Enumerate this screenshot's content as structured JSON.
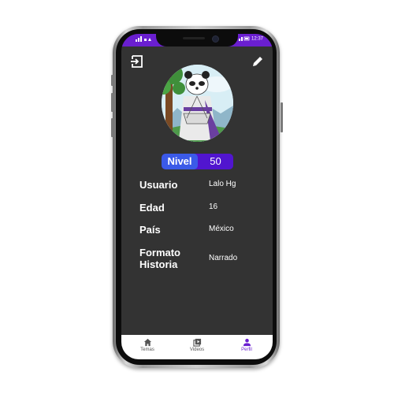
{
  "statusbar": {
    "left_text": "",
    "time": "12:37"
  },
  "header": {
    "logout_icon": "logout-icon",
    "edit_icon": "pencil-icon"
  },
  "profile": {
    "level_label": "Nivel",
    "level_value": "50",
    "fields": [
      {
        "label": "Usuario",
        "value": "Lalo Hg"
      },
      {
        "label": "Edad",
        "value": "16"
      },
      {
        "label": "País",
        "value": "México"
      },
      {
        "label": "Formato\nHistoria",
        "value": "Narrado"
      }
    ]
  },
  "nav": {
    "items": [
      {
        "label": "Temas",
        "icon": "home-icon",
        "active": false
      },
      {
        "label": "Videos",
        "icon": "video-library-icon",
        "active": false
      },
      {
        "label": "Perfil",
        "icon": "person-icon",
        "active": true
      }
    ]
  },
  "colors": {
    "accent": "#6a1fd0",
    "pill_label": "#3b5ae8",
    "pill_bg": "#5115cf",
    "screen_bg": "#333333"
  }
}
